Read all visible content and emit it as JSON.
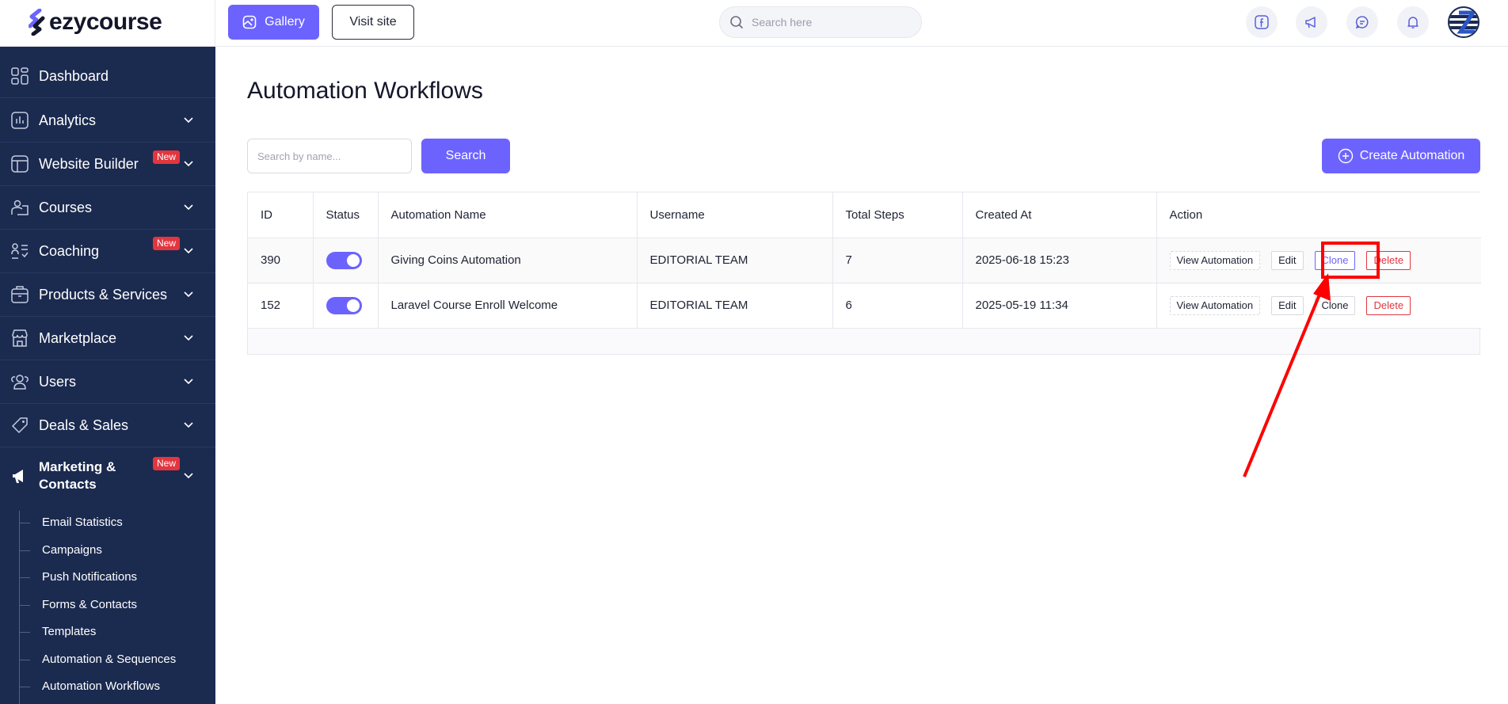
{
  "app": {
    "name": "ezycourse"
  },
  "topbar": {
    "gallery_label": "Gallery",
    "visit_label": "Visit site",
    "search_placeholder": "Search here"
  },
  "sidebar": {
    "items": [
      {
        "label": "Dashboard",
        "icon": "grid-icon"
      },
      {
        "label": "Analytics",
        "icon": "chart-icon"
      },
      {
        "label": "Website Builder",
        "icon": "layout-icon",
        "badge": "New"
      },
      {
        "label": "Courses",
        "icon": "courses-icon"
      },
      {
        "label": "Coaching",
        "icon": "coaching-icon",
        "badge": "New"
      },
      {
        "label": "Products & Services",
        "icon": "bag-icon"
      },
      {
        "label": "Marketplace",
        "icon": "store-icon"
      },
      {
        "label": "Users",
        "icon": "users-icon"
      },
      {
        "label": "Deals & Sales",
        "icon": "tag-icon"
      },
      {
        "label": "Marketing &",
        "label2": "Contacts",
        "icon": "megaphone-icon",
        "badge": "New"
      }
    ],
    "sub_items": [
      "Email Statistics",
      "Campaigns",
      "Push Notifications",
      "Forms & Contacts",
      "Templates",
      "Automation & Sequences",
      "Automation Workflows"
    ]
  },
  "main": {
    "title": "Automation Workflows",
    "search_placeholder": "Search by name...",
    "search_button": "Search",
    "create_button": "Create Automation",
    "table": {
      "headers": [
        "ID",
        "Status",
        "Automation Name",
        "Username",
        "Total Steps",
        "Created At",
        "Action"
      ],
      "rows": [
        {
          "id": "390",
          "status": "on",
          "name": "Giving Coins Automation",
          "username": "EDITORIAL TEAM",
          "steps": "7",
          "created": "2025-06-18 15:23"
        },
        {
          "id": "152",
          "status": "on",
          "name": "Laravel Course Enroll Welcome",
          "username": "EDITORIAL TEAM",
          "steps": "6",
          "created": "2025-05-19 11:34"
        }
      ],
      "actions": {
        "view": "View Automation",
        "edit": "Edit",
        "clone": "Clone",
        "delete": "Delete"
      }
    }
  },
  "colors": {
    "accent": "#6c63ff",
    "sidebar_bg": "#1b2a4f",
    "danger": "#e2363f",
    "annotation": "#ff0000"
  }
}
